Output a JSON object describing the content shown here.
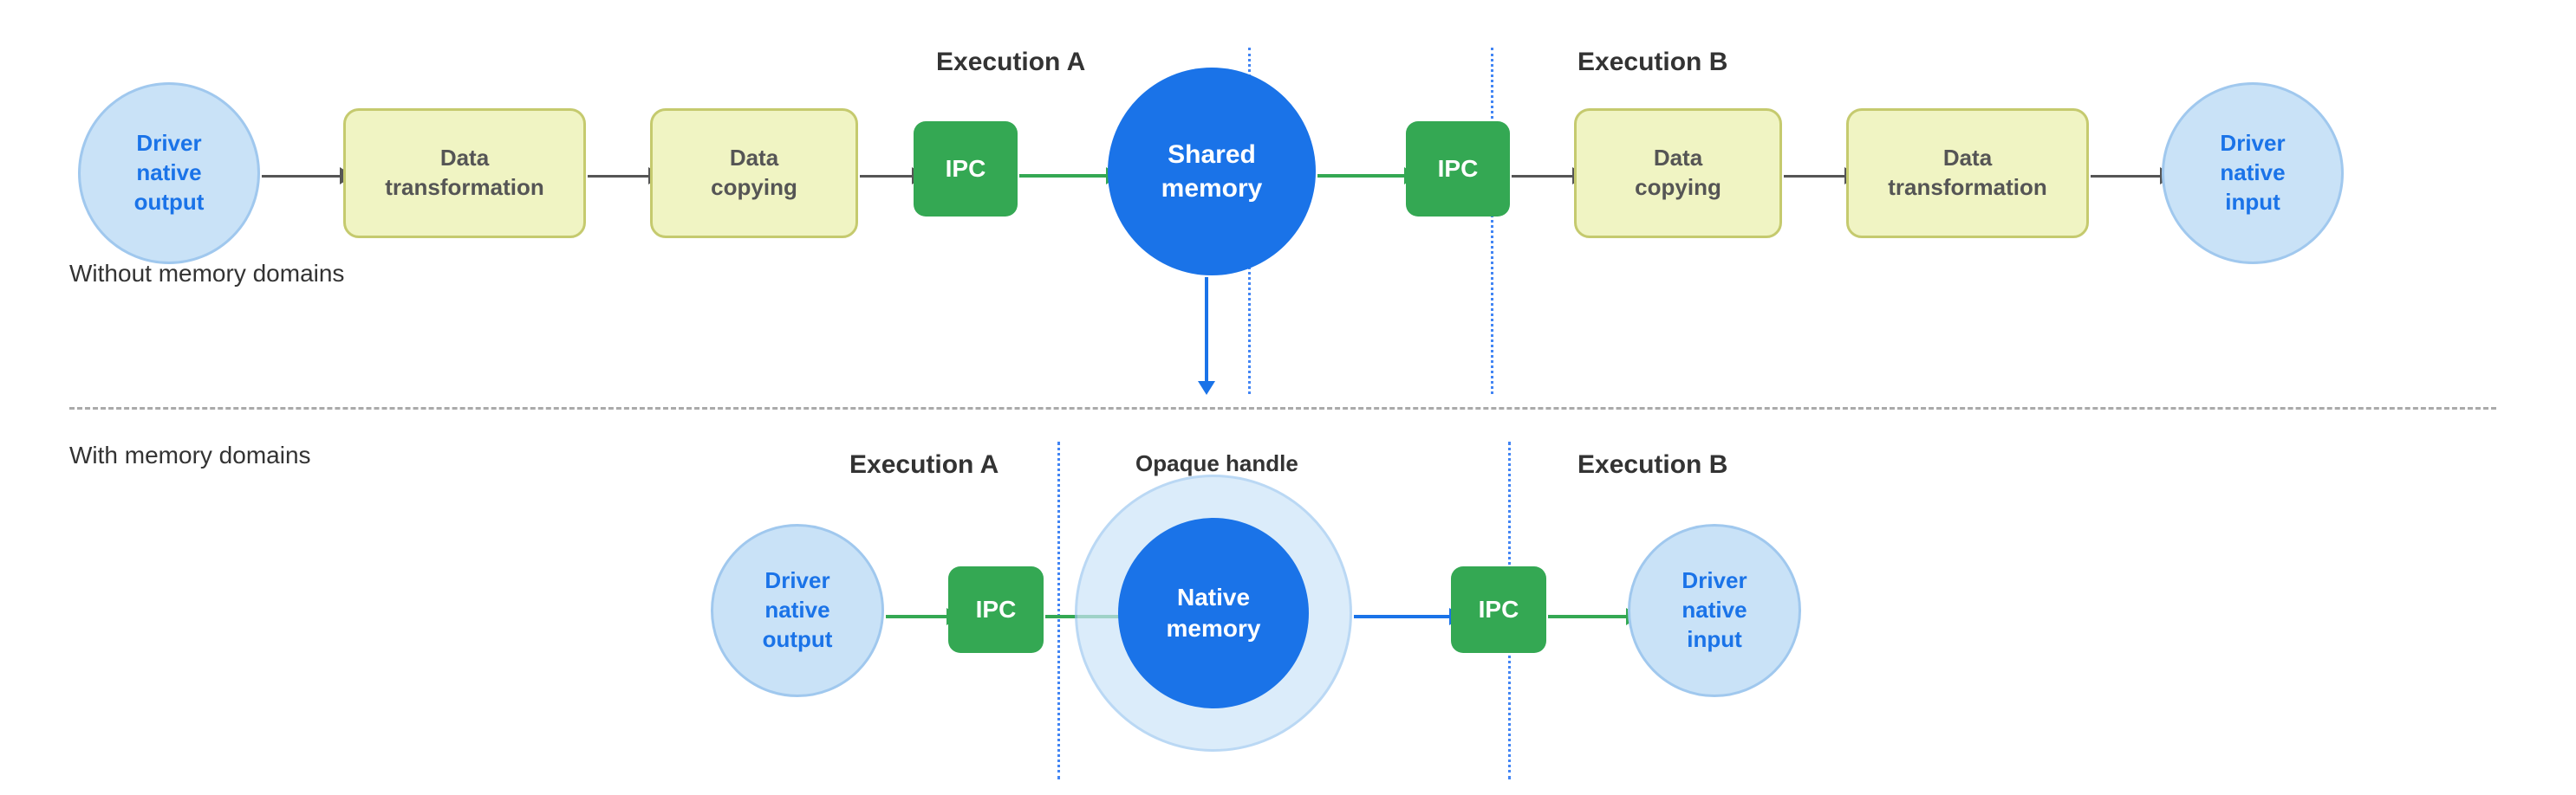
{
  "sections": {
    "without_label": "Without memory domains",
    "with_label": "With memory domains"
  },
  "top_row": {
    "exec_a_label": "Execution A",
    "exec_b_label": "Execution B",
    "nodes": [
      {
        "id": "driver-native-output-top",
        "text": "Driver\nnative\noutput",
        "type": "circle-blue-light"
      },
      {
        "id": "data-transform-1",
        "text": "Data\ntransformation",
        "type": "rect-yellow"
      },
      {
        "id": "data-copying-1",
        "text": "Data\ncopying",
        "type": "rect-yellow"
      },
      {
        "id": "ipc-1",
        "text": "IPC",
        "type": "rect-green"
      },
      {
        "id": "shared-memory",
        "text": "Shared\nmemory",
        "type": "circle-blue-big"
      },
      {
        "id": "ipc-2",
        "text": "IPC",
        "type": "rect-green"
      },
      {
        "id": "data-copying-2",
        "text": "Data\ncopying",
        "type": "rect-yellow"
      },
      {
        "id": "data-transform-2",
        "text": "Data\ntransformation",
        "type": "rect-yellow"
      },
      {
        "id": "driver-native-input-top",
        "text": "Driver\nnative\ninput",
        "type": "circle-blue-light"
      }
    ]
  },
  "bottom_row": {
    "exec_a_label": "Execution A",
    "exec_b_label": "Execution B",
    "opaque_label": "Opaque handle",
    "nodes": [
      {
        "id": "driver-native-output-bot",
        "text": "Driver\nnative\noutput",
        "type": "circle-blue-light"
      },
      {
        "id": "ipc-3",
        "text": "IPC",
        "type": "rect-green"
      },
      {
        "id": "native-memory-bg",
        "text": "",
        "type": "circle-light-large"
      },
      {
        "id": "native-memory",
        "text": "Native\nmemory",
        "type": "circle-blue-medium"
      },
      {
        "id": "ipc-4",
        "text": "IPC",
        "type": "rect-green"
      },
      {
        "id": "driver-native-input-bot",
        "text": "Driver\nnative\ninput",
        "type": "circle-blue-light"
      }
    ]
  }
}
